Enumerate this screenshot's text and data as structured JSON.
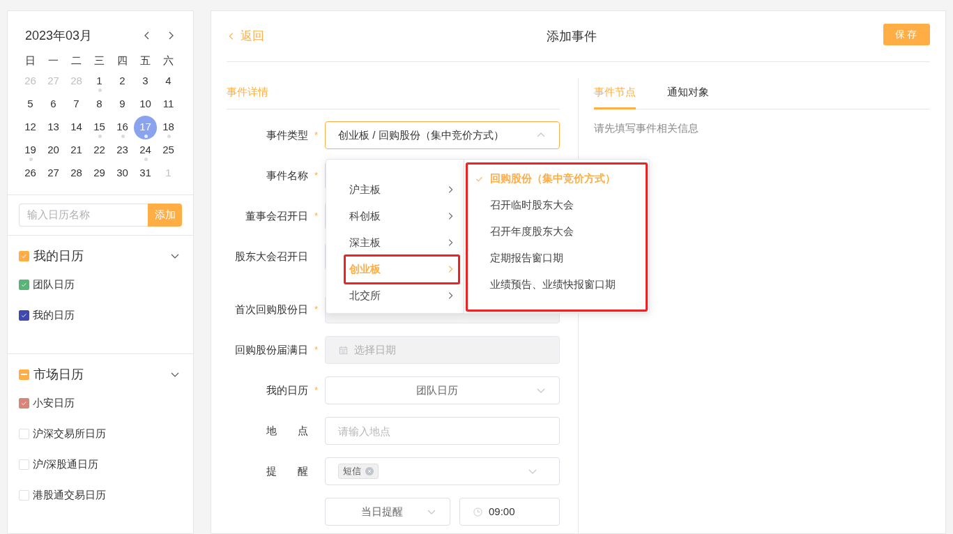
{
  "calendar": {
    "month": "2023年03月",
    "weekdays": [
      "日",
      "一",
      "二",
      "三",
      "四",
      "五",
      "六"
    ],
    "weeks": [
      [
        {
          "day": "26",
          "other_month": true,
          "has_events": false,
          "selected": false
        },
        {
          "day": "27",
          "other_month": true,
          "has_events": false,
          "selected": false
        },
        {
          "day": "28",
          "other_month": true,
          "has_events": false,
          "selected": false
        },
        {
          "day": "1",
          "other_month": false,
          "has_events": true,
          "selected": false
        },
        {
          "day": "2",
          "other_month": false,
          "has_events": false,
          "selected": false
        },
        {
          "day": "3",
          "other_month": false,
          "has_events": false,
          "selected": false
        },
        {
          "day": "4",
          "other_month": false,
          "has_events": false,
          "selected": false
        }
      ],
      [
        {
          "day": "5",
          "other_month": false,
          "has_events": false,
          "selected": false
        },
        {
          "day": "6",
          "other_month": false,
          "has_events": false,
          "selected": false
        },
        {
          "day": "7",
          "other_month": false,
          "has_events": false,
          "selected": false
        },
        {
          "day": "8",
          "other_month": false,
          "has_events": false,
          "selected": false
        },
        {
          "day": "9",
          "other_month": false,
          "has_events": false,
          "selected": false
        },
        {
          "day": "10",
          "other_month": false,
          "has_events": false,
          "selected": false
        },
        {
          "day": "11",
          "other_month": false,
          "has_events": false,
          "selected": false
        }
      ],
      [
        {
          "day": "12",
          "other_month": false,
          "has_events": false,
          "selected": false
        },
        {
          "day": "13",
          "other_month": false,
          "has_events": false,
          "selected": false
        },
        {
          "day": "14",
          "other_month": false,
          "has_events": false,
          "selected": false
        },
        {
          "day": "15",
          "other_month": false,
          "has_events": true,
          "selected": false
        },
        {
          "day": "16",
          "other_month": false,
          "has_events": true,
          "selected": false
        },
        {
          "day": "17",
          "other_month": false,
          "has_events": true,
          "selected": true
        },
        {
          "day": "18",
          "other_month": false,
          "has_events": true,
          "selected": false
        }
      ],
      [
        {
          "day": "19",
          "other_month": false,
          "has_events": true,
          "selected": false
        },
        {
          "day": "20",
          "other_month": false,
          "has_events": false,
          "selected": false
        },
        {
          "day": "21",
          "other_month": false,
          "has_events": false,
          "selected": false
        },
        {
          "day": "22",
          "other_month": false,
          "has_events": false,
          "selected": false
        },
        {
          "day": "23",
          "other_month": false,
          "has_events": false,
          "selected": false
        },
        {
          "day": "24",
          "other_month": false,
          "has_events": true,
          "selected": false
        },
        {
          "day": "25",
          "other_month": false,
          "has_events": false,
          "selected": false
        }
      ],
      [
        {
          "day": "26",
          "other_month": false,
          "has_events": false,
          "selected": false
        },
        {
          "day": "27",
          "other_month": false,
          "has_events": false,
          "selected": false
        },
        {
          "day": "28",
          "other_month": false,
          "has_events": false,
          "selected": false
        },
        {
          "day": "29",
          "other_month": false,
          "has_events": false,
          "selected": false
        },
        {
          "day": "30",
          "other_month": false,
          "has_events": false,
          "selected": false
        },
        {
          "day": "31",
          "other_month": false,
          "has_events": false,
          "selected": false
        },
        {
          "day": "1",
          "other_month": true,
          "has_events": false,
          "selected": false
        }
      ]
    ]
  },
  "add_calendar": {
    "placeholder": "输入日历名称",
    "button": "添加"
  },
  "calendar_groups": [
    {
      "label": "我的日历",
      "checked": true,
      "color": "#ffad45",
      "expanded": true,
      "items": [
        {
          "label": "团队日历",
          "checked": true,
          "color": "#5ab47a"
        },
        {
          "label": "我的日历",
          "checked": true,
          "color": "#3f4ab0"
        }
      ]
    },
    {
      "label": "市场日历",
      "indeterminate": true,
      "color": "#ffad45",
      "expanded": true,
      "items": [
        {
          "label": "小安日历",
          "checked": true,
          "color": "#d9867a"
        },
        {
          "label": "沪深交易所日历",
          "checked": false,
          "color": "#dcdfe6"
        },
        {
          "label": "沪/深股通日历",
          "checked": false,
          "color": "#dcdfe6"
        },
        {
          "label": "港股通交易日历",
          "checked": false,
          "color": "#dcdfe6"
        }
      ]
    }
  ],
  "header": {
    "back": "返回",
    "title": "添加事件",
    "save": "保存"
  },
  "section_title": "事件详情",
  "form_rows": [
    {
      "label": "事件类型",
      "required_mark": "*",
      "kind": "select",
      "value": "创业板 / 回购股份（集中竞价方式）",
      "open": true
    },
    {
      "label": "事件名称",
      "required_mark": "*",
      "kind": "covered"
    },
    {
      "label": "董事会召开日",
      "required_mark": "*",
      "kind": "covered"
    },
    {
      "label": "股东大会召开日",
      "kind": "covered"
    },
    {
      "label": "首次回购股份日",
      "required_mark": "*",
      "kind": "covered",
      "disabled": true
    },
    {
      "label": "回购股份届满日",
      "required_mark": "*",
      "kind": "date",
      "placeholder": "选择日期",
      "disabled": true
    },
    {
      "label": "我的日历",
      "required_mark": "*",
      "kind": "select",
      "value": "团队日历",
      "open": false
    },
    {
      "label": "地　　点",
      "kind": "input",
      "placeholder": "请输入地点"
    },
    {
      "label": "提　　醒",
      "kind": "tags",
      "tags": [
        "短信"
      ]
    },
    {
      "kind": "pair",
      "select": "当日提醒",
      "time": "09:00"
    }
  ],
  "cascader": {
    "columns": [
      {
        "highlighted": false,
        "items": [
          {
            "label": "沪主板",
            "selected": false,
            "has_children": true,
            "highlighted": false
          },
          {
            "label": "科创板",
            "selected": false,
            "has_children": true,
            "highlighted": false
          },
          {
            "label": "深主板",
            "selected": false,
            "has_children": true,
            "highlighted": false
          },
          {
            "label": "创业板",
            "selected": true,
            "has_children": true,
            "highlighted": true
          },
          {
            "label": "北交所",
            "selected": false,
            "has_children": true,
            "highlighted": false
          }
        ]
      },
      {
        "highlighted": true,
        "items": [
          {
            "label": "回购股份（集中竞价方式）",
            "selected": true,
            "has_children": false,
            "highlighted": false
          },
          {
            "label": "召开临时股东大会",
            "selected": false,
            "has_children": false,
            "highlighted": false
          },
          {
            "label": "召开年度股东大会",
            "selected": false,
            "has_children": false,
            "highlighted": false
          },
          {
            "label": "定期报告窗口期",
            "selected": false,
            "has_children": false,
            "highlighted": false
          },
          {
            "label": "业绩预告、业绩快报窗口期",
            "selected": false,
            "has_children": false,
            "highlighted": false
          }
        ]
      }
    ]
  },
  "side_tabs": [
    {
      "label": "事件节点",
      "selected": true
    },
    {
      "label": "通知对象",
      "selected": false
    }
  ],
  "side_hint": "请先填写事件相关信息"
}
